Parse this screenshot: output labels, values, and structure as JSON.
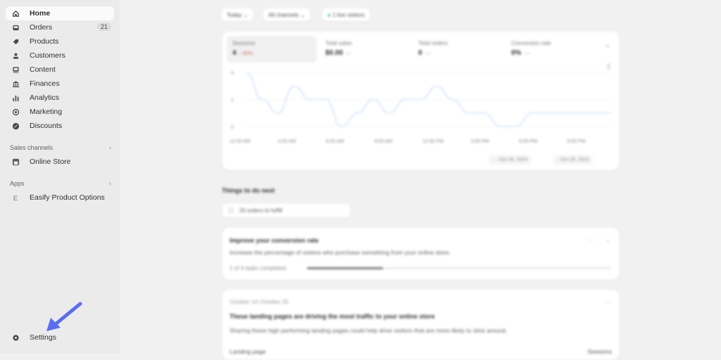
{
  "sidebar": {
    "items": [
      {
        "label": "Home",
        "icon": "home-icon",
        "active": true
      },
      {
        "label": "Orders",
        "icon": "inbox-icon",
        "badge": "21"
      },
      {
        "label": "Products",
        "icon": "tag-icon"
      },
      {
        "label": "Customers",
        "icon": "person-icon"
      },
      {
        "label": "Content",
        "icon": "image-icon"
      },
      {
        "label": "Finances",
        "icon": "bank-icon"
      },
      {
        "label": "Analytics",
        "icon": "bar-chart-icon"
      },
      {
        "label": "Marketing",
        "icon": "target-icon"
      },
      {
        "label": "Discounts",
        "icon": "discount-icon"
      }
    ],
    "sales_channels": {
      "heading": "Sales channels",
      "items": [
        {
          "label": "Online Store",
          "icon": "store-icon"
        }
      ]
    },
    "apps": {
      "heading": "Apps",
      "items": [
        {
          "label": "Easify Product Options",
          "icon": "app-icon"
        }
      ]
    },
    "settings": {
      "label": "Settings",
      "icon": "gear-icon"
    }
  },
  "filters": {
    "date": "Today",
    "channels": "All channels",
    "live": "1 live visitors"
  },
  "metrics": [
    {
      "label": "Sessions",
      "value": "4",
      "delta": "↓ 60%"
    },
    {
      "label": "Total sales",
      "value": "$0.00",
      "delta": "—"
    },
    {
      "label": "Total orders",
      "value": "0",
      "delta": "—"
    },
    {
      "label": "Conversion rate",
      "value": "0%",
      "delta": "—"
    }
  ],
  "chart_data": {
    "type": "line",
    "x": [
      "12:00 AM",
      "3:00 AM",
      "6:00 AM",
      "9:00 AM",
      "12:00 PM",
      "3:00 PM",
      "6:00 PM",
      "9:00 PM"
    ],
    "yticks": [
      "4",
      "2",
      "0"
    ],
    "ylim": [
      0,
      4
    ],
    "series": [
      {
        "name": "Oct 26, 2023",
        "color": "#cfe3f8",
        "values": [
          4,
          2,
          1,
          3,
          2,
          2,
          0,
          1,
          2,
          1,
          2,
          2,
          3,
          2,
          1,
          1,
          0,
          0,
          1,
          1,
          1,
          1,
          1,
          1
        ]
      },
      {
        "name": "Oct 25, 2023",
        "color": "#e3e3e3",
        "values": []
      }
    ],
    "legend": [
      "Oct 26, 2023",
      "Oct 25, 2023"
    ]
  },
  "things_to_do": {
    "heading": "Things to do next",
    "orders_pill": "20 orders to fulfill",
    "conversion": {
      "title": "Improve your conversion rate",
      "desc": "Increase the percentage of visitors who purchase something from your online store.",
      "progress_label": "1 of 4 tasks completed",
      "progress": 0.25
    },
    "landing": {
      "date_range": "October 14–October 20",
      "title": "These landing pages are driving the most traffic to your online store",
      "desc": "Sharing these high performing landing pages could help drive visitors that are more likely to stick around.",
      "col_left": "Landing page",
      "col_right": "Sessions"
    }
  }
}
